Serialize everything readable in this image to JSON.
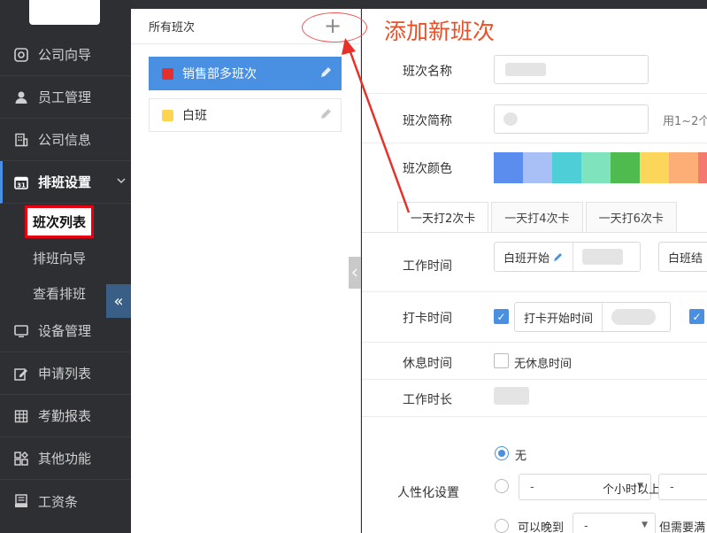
{
  "sidebar": {
    "items": [
      {
        "label": "公司向导",
        "icon": "compass-icon"
      },
      {
        "label": "员工管理",
        "icon": "user-icon"
      },
      {
        "label": "公司信息",
        "icon": "building-icon"
      },
      {
        "label": "排班设置",
        "icon": "calendar-icon"
      },
      {
        "label": "设备管理",
        "icon": "monitor-icon"
      },
      {
        "label": "申请列表",
        "icon": "edit-icon"
      },
      {
        "label": "考勤报表",
        "icon": "grid-icon"
      },
      {
        "label": "其他功能",
        "icon": "apps-icon"
      },
      {
        "label": "工资条",
        "icon": "payslip-icon"
      }
    ],
    "sub_items": [
      "班次列表",
      "排班向导",
      "查看排班"
    ],
    "collapse_glyph": "«"
  },
  "shift_panel": {
    "title": "所有班次",
    "add_glyph": "+",
    "shifts": [
      {
        "name": "销售部多班次",
        "color": "#e52f2f"
      },
      {
        "name": "白班",
        "color": "#ffd54f"
      }
    ]
  },
  "annotation": {
    "text": "添加新班次",
    "color": "#e8502a"
  },
  "form": {
    "name_label": "班次名称",
    "short_label": "班次简称",
    "short_hint": "用1~2个",
    "color_label": "班次颜色",
    "palette": [
      "#5b8def",
      "#a9c0f7",
      "#4ecfd7",
      "#7fe3bd",
      "#4fba4e",
      "#fcd55b",
      "#fcae76",
      "#f27a6e"
    ],
    "tabs": [
      "一天打2次卡",
      "一天打4次卡",
      "一天打6次卡"
    ],
    "work_time_label": "工作时间",
    "work_start": "白班开始",
    "work_end": "白班结",
    "punch_label": "打卡时间",
    "punch_start": "打卡开始时间",
    "rest_label": "休息时间",
    "no_rest": "无休息时间",
    "duration_label": "工作时长",
    "humanize_label": "人性化设置",
    "opt_none": "无",
    "opt_dash": "-",
    "opt_late": "可以晚到",
    "opt_tail": "但需要满",
    "opt_mid": "个小时以上"
  }
}
